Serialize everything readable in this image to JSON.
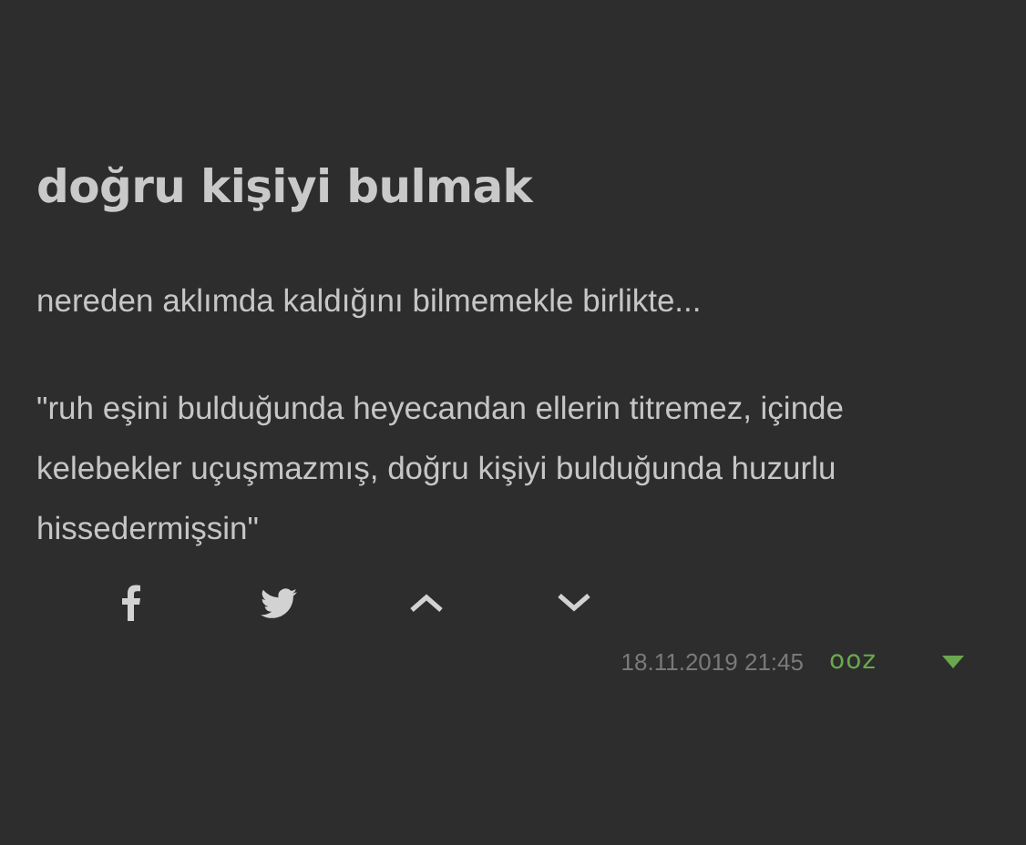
{
  "entry": {
    "title": "doğru kişiyi bulmak",
    "paragraphs": [
      "nereden aklımda kaldığını bilmemekle birlikte...",
      "\"ruh eşini bulduğunda heyecandan ellerin titremez, içinde kelebekler uçuşmazmış, doğru kişiyi bulduğunda huzurlu hissedermişsin\""
    ],
    "date": "18.11.2019 21:45",
    "author": "ooz"
  }
}
